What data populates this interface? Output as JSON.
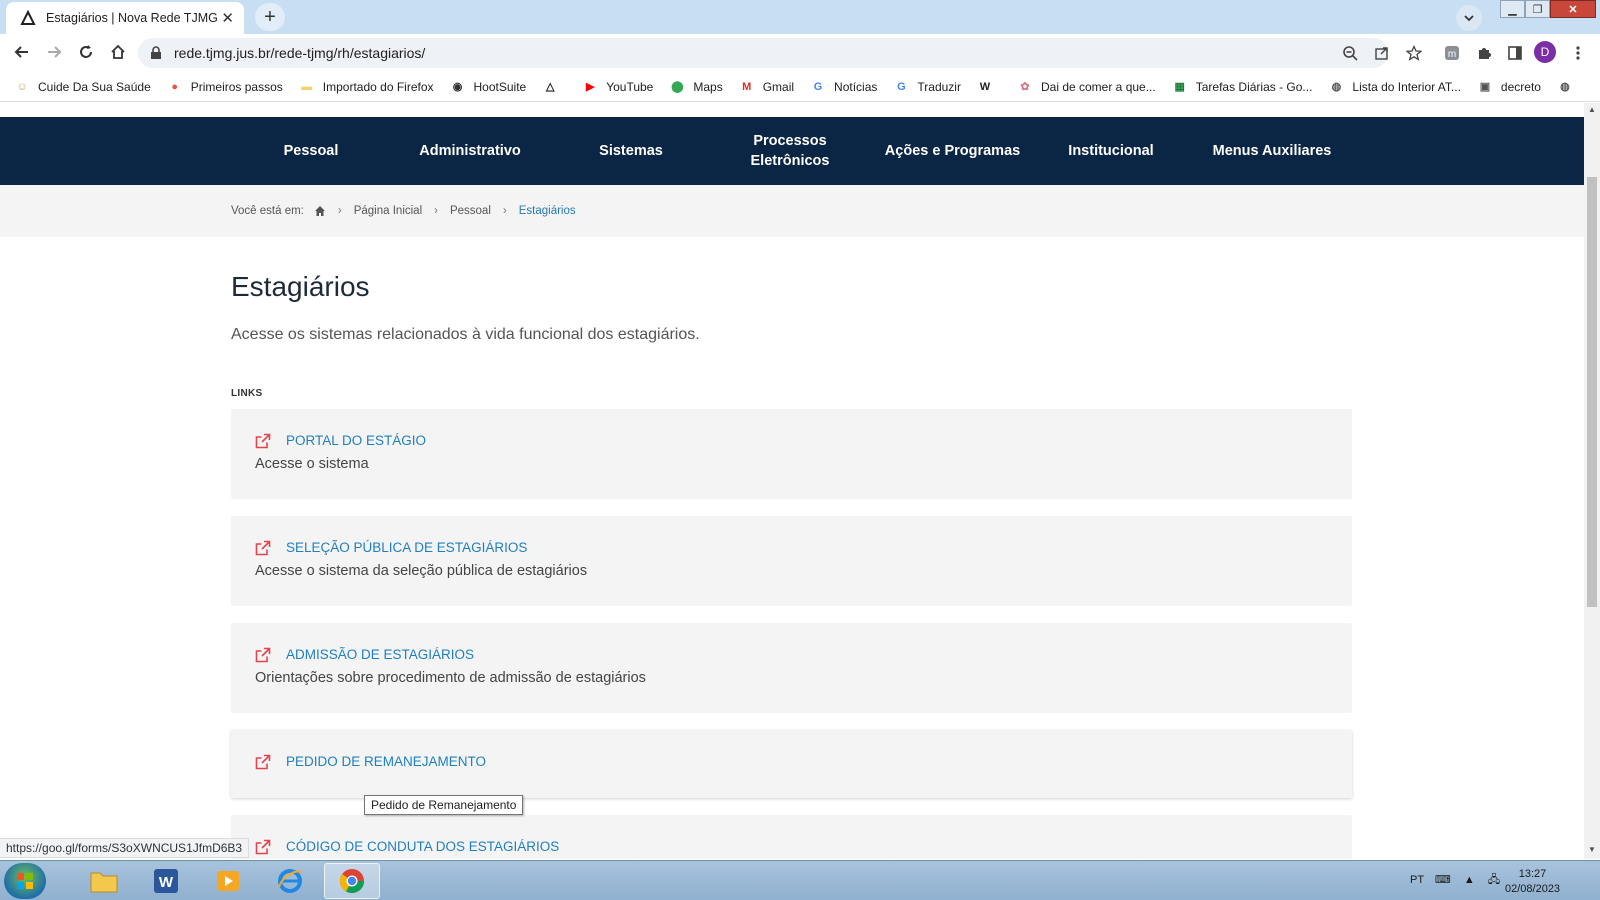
{
  "browser": {
    "tab_title": "Estagiários | Nova Rede TJMG",
    "url": "rede.tjmg.jus.br/rede-tjmg/rh/estagiarios/",
    "profile_initial": "D",
    "bookmarks": [
      {
        "label": "Cuide Da Sua Saúde",
        "icon": "health-icon",
        "color": "#c9a45a"
      },
      {
        "label": "Primeiros passos",
        "icon": "firefox-icon",
        "color": "#e8553a"
      },
      {
        "label": "Importado do Firefox",
        "icon": "folder-icon",
        "color": "#f4d36b"
      },
      {
        "label": "HootSuite",
        "icon": "owl-icon",
        "color": "#333333"
      },
      {
        "label": "",
        "icon": "triangle-icon",
        "color": "#222222"
      },
      {
        "label": "YouTube",
        "icon": "youtube-icon",
        "color": "#ff0000"
      },
      {
        "label": "Maps",
        "icon": "maps-icon",
        "color": "#34a853"
      },
      {
        "label": "Gmail",
        "icon": "gmail-icon",
        "color": "#d93025"
      },
      {
        "label": "Notícias",
        "icon": "news-icon",
        "color": "#4285f4"
      },
      {
        "label": "Traduzir",
        "icon": "translate-icon",
        "color": "#4285f4"
      },
      {
        "label": "",
        "icon": "wikipedia-icon",
        "color": "#222222"
      },
      {
        "label": "Dai de comer a que...",
        "icon": "globe-pink-icon",
        "color": "#d77c8c"
      },
      {
        "label": "Tarefas Diárias - Go...",
        "icon": "sheets-icon",
        "color": "#188038"
      },
      {
        "label": "Lista do Interior AT...",
        "icon": "globe-icon",
        "color": "#555555"
      },
      {
        "label": "decreto",
        "icon": "image-icon",
        "color": "#555555"
      },
      {
        "label": "",
        "icon": "globe-icon",
        "color": "#555555"
      }
    ]
  },
  "nav": {
    "items": [
      "Pessoal",
      "Administrativo",
      "Sistemas",
      "Processos Eletrônicos",
      "Ações e Programas",
      "Institucional",
      "Menus Auxiliares"
    ]
  },
  "breadcrumb": {
    "prefix": "Você está em:",
    "items": [
      "Página Inicial",
      "Pessoal"
    ],
    "current": "Estagiários"
  },
  "page": {
    "title": "Estagiários",
    "lead": "Acesse os sistemas relacionados à vida funcional dos estagiários.",
    "links_header": "LINKS",
    "links": [
      {
        "title": "Portal do Estágio",
        "desc": "Acesse o sistema"
      },
      {
        "title": "Seleção Pública de Estagiários",
        "desc": "Acesse o sistema da seleção pública de estagiários"
      },
      {
        "title": "Admissão de Estagiários",
        "desc": "Orientações sobre procedimento de admissão de estagiários"
      },
      {
        "title": "Pedido de Remanejamento",
        "desc": ""
      },
      {
        "title": "Código de Conduta dos Estagiários",
        "desc": ""
      }
    ]
  },
  "tooltip": "Pedido de Remanejamento",
  "status_url": "https://goo.gl/forms/S3oXWNCUS1JfmD6B3",
  "taskbar": {
    "lang": "PT",
    "time": "13:27",
    "date": "02/08/2023"
  },
  "colors": {
    "nav_bg": "#0b2545",
    "link": "#1f7fbf",
    "external_icon": "#e0474c"
  }
}
